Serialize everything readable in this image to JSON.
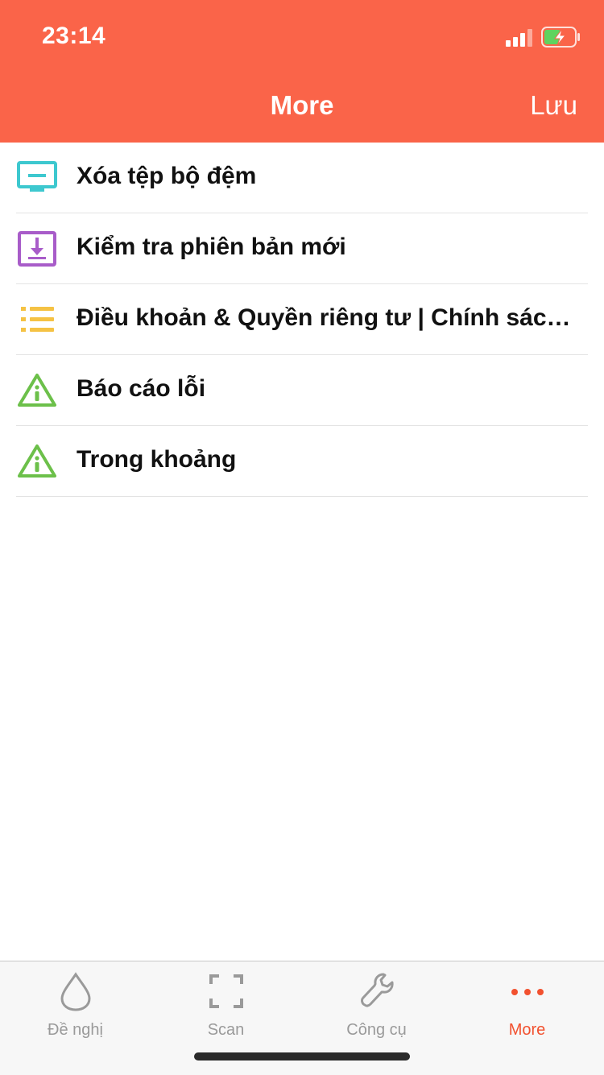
{
  "status_bar": {
    "time": "23:14"
  },
  "nav": {
    "title": "More",
    "right_action": "Lưu"
  },
  "menu": [
    {
      "label": "Xóa tệp bộ đệm",
      "icon": "monitor-icon",
      "color": "#3dc8cf"
    },
    {
      "label": "Kiểm tra phiên bản mới",
      "icon": "download-box-icon",
      "color": "#a85cc9"
    },
    {
      "label": "Điều khoản & Quyền riêng tư | Chính sách bảo mật",
      "icon": "list-icon",
      "color": "#f5c244"
    },
    {
      "label": "Báo cáo lỗi",
      "icon": "info-triangle-icon",
      "color": "#6cc04a"
    },
    {
      "label": "Trong khoảng",
      "icon": "info-triangle-icon",
      "color": "#6cc04a"
    }
  ],
  "tabbar": {
    "tabs": [
      {
        "label": "Đề nghị",
        "icon": "drop-icon"
      },
      {
        "label": "Scan",
        "icon": "scan-frame-icon"
      },
      {
        "label": "Công cụ",
        "icon": "wrench-icon"
      },
      {
        "label": "More",
        "icon": "more-dots-icon",
        "active": true
      }
    ]
  },
  "colors": {
    "header": "#fa6449",
    "accent": "#f2512f"
  }
}
